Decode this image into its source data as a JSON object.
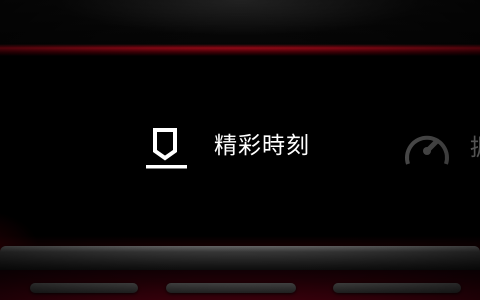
{
  "menu": {
    "items": [
      {
        "label": "精彩時刻",
        "icon": "bookmark-icon"
      },
      {
        "label": "",
        "icon": "speedometer-icon"
      }
    ],
    "partial_label": "据"
  },
  "colors": {
    "background": "#000000",
    "text": "#ffffff",
    "accent_red": "#a0101a",
    "device_bar": "#3a3a3a"
  }
}
